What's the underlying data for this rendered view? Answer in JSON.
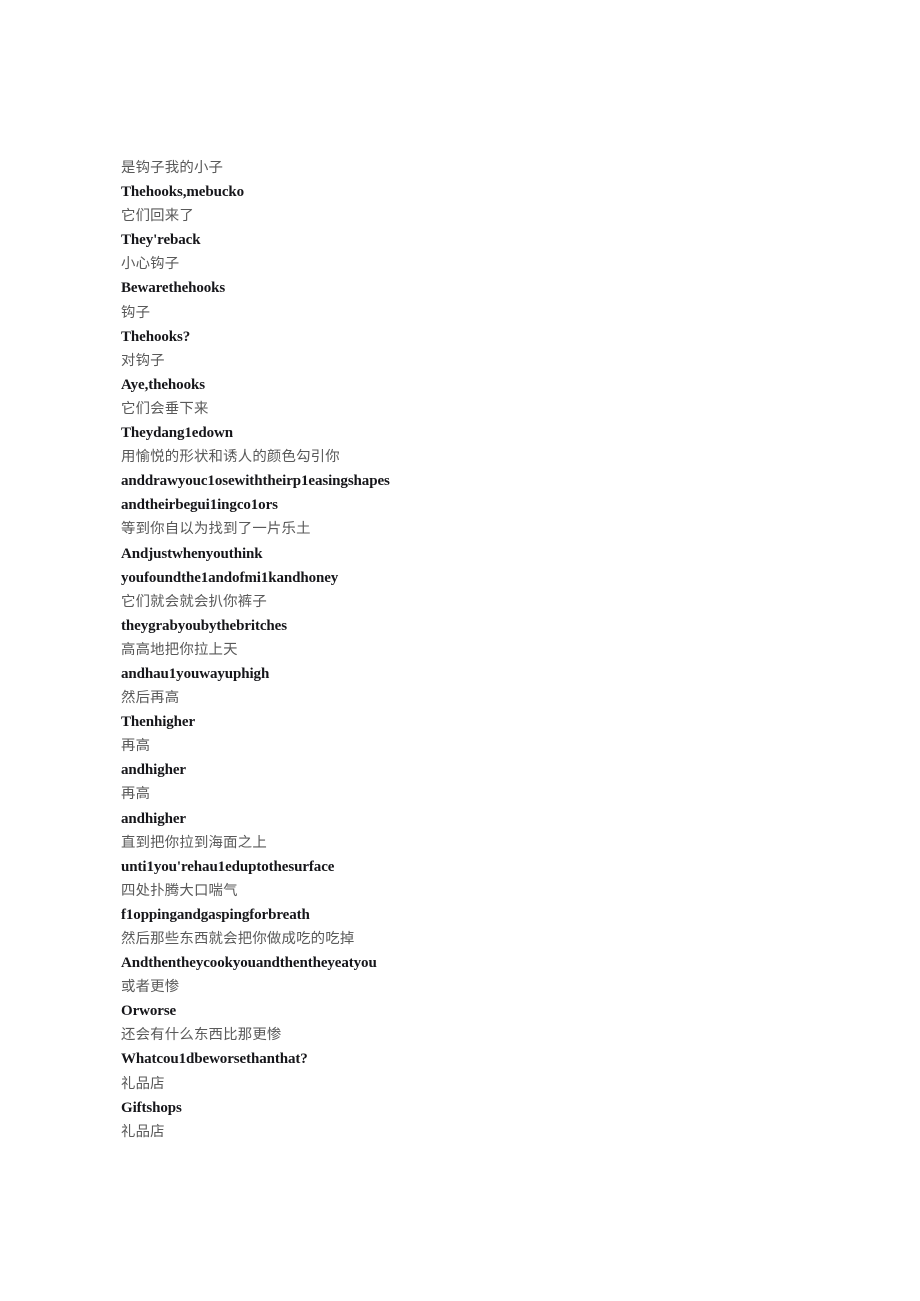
{
  "document": {
    "background_color": "#ffffff",
    "zh_text_color": "#595959",
    "en_text_color": "#16161a",
    "lines": [
      {
        "lang": "zh",
        "text": "是钩子我的小子"
      },
      {
        "lang": "en",
        "text": "Thehooks,mebucko"
      },
      {
        "lang": "zh",
        "text": "它们回来了"
      },
      {
        "lang": "en",
        "text": "They'reback"
      },
      {
        "lang": "zh",
        "text": "小心钩子"
      },
      {
        "lang": "en",
        "text": "Bewarethehooks"
      },
      {
        "lang": "zh",
        "text": "钩子"
      },
      {
        "lang": "en",
        "text": "Thehooks?"
      },
      {
        "lang": "zh",
        "text": "对钩子"
      },
      {
        "lang": "en",
        "text": "Aye,thehooks"
      },
      {
        "lang": "zh",
        "text": "它们会垂下来"
      },
      {
        "lang": "en",
        "text": "Theydang1edown"
      },
      {
        "lang": "zh",
        "text": "用愉悦的形状和诱人的颜色勾引你"
      },
      {
        "lang": "en",
        "text": "anddrawyouc1osewiththeirp1easingshapes"
      },
      {
        "lang": "en",
        "text": "andtheirbegui1ingco1ors"
      },
      {
        "lang": "zh",
        "text": "等到你自以为找到了一片乐土"
      },
      {
        "lang": "en",
        "text": "Andjustwhenyouthink"
      },
      {
        "lang": "en",
        "text": "youfoundthe1andofmi1kandhoney"
      },
      {
        "lang": "zh",
        "text": "它们就会就会扒你裤子"
      },
      {
        "lang": "en",
        "text": "theygrabyoubythebritches"
      },
      {
        "lang": "zh",
        "text": "高高地把你拉上天"
      },
      {
        "lang": "en",
        "text": "andhau1youwayuphigh"
      },
      {
        "lang": "zh",
        "text": "然后再高"
      },
      {
        "lang": "en",
        "text": "Thenhigher"
      },
      {
        "lang": "zh",
        "text": "再高"
      },
      {
        "lang": "en",
        "text": "andhigher"
      },
      {
        "lang": "zh",
        "text": "再高"
      },
      {
        "lang": "en",
        "text": "andhigher"
      },
      {
        "lang": "zh",
        "text": "直到把你拉到海面之上"
      },
      {
        "lang": "en",
        "text": "unti1you'rehau1eduptothesurface"
      },
      {
        "lang": "zh",
        "text": "四处扑腾大口喘气"
      },
      {
        "lang": "en",
        "text": "f1oppingandgaspingforbreath"
      },
      {
        "lang": "zh",
        "text": "然后那些东西就会把你做成吃的吃掉"
      },
      {
        "lang": "en",
        "text": "Andthentheycookyouandthentheyeatyou"
      },
      {
        "lang": "zh",
        "text": "或者更惨"
      },
      {
        "lang": "en",
        "text": "Orworse"
      },
      {
        "lang": "zh",
        "text": "还会有什么东西比那更惨"
      },
      {
        "lang": "en",
        "text": "Whatcou1dbeworsethanthat?"
      },
      {
        "lang": "zh",
        "text": "礼品店"
      },
      {
        "lang": "en",
        "text": "Giftshops"
      },
      {
        "lang": "zh",
        "text": "礼品店"
      }
    ]
  }
}
